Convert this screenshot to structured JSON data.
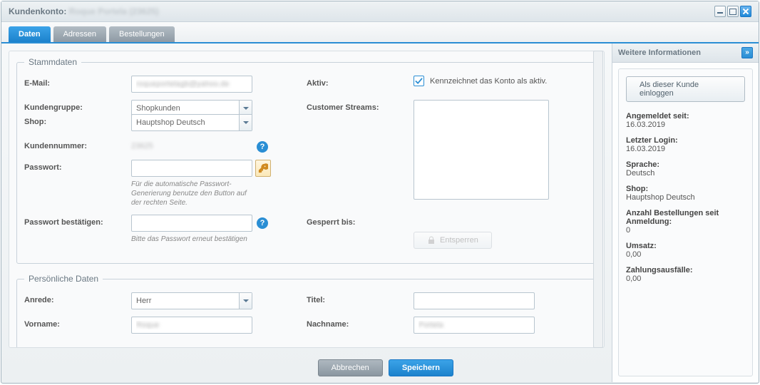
{
  "window": {
    "title_prefix": "Kundenkonto: ",
    "title_name": "Roque Portela (23625)"
  },
  "tabs": {
    "daten": "Daten",
    "adressen": "Adressen",
    "bestellungen": "Bestellungen"
  },
  "stammdaten": {
    "legend": "Stammdaten",
    "email_label": "E-Mail:",
    "email_value": "roqueportelagb@yahoo.de",
    "kundengruppe_label": "Kundengruppe:",
    "kundengruppe_value": "Shopkunden",
    "shop_label": "Shop:",
    "shop_value": "Hauptshop Deutsch",
    "kundennummer_label": "Kundennummer:",
    "kundennummer_value": "23625",
    "passwort_label": "Passwort:",
    "passwort_help": "Für die automatische Passwort-Generierung benutze den Button auf der rechten Seite.",
    "passwort_confirm_label": "Passwort bestätigen:",
    "passwort_confirm_help": "Bitte das Passwort erneut bestätigen",
    "aktiv_label": "Aktiv:",
    "aktiv_help": "Kennzeichnet das Konto als aktiv.",
    "streams_label": "Customer Streams:",
    "gesperrt_label": "Gesperrt bis:",
    "entsperren": "Entsperren"
  },
  "persoenlich": {
    "legend": "Persönliche Daten",
    "anrede_label": "Anrede:",
    "anrede_value": "Herr",
    "titel_label": "Titel:",
    "titel_value": "",
    "vorname_label": "Vorname:",
    "vorname_value": "Roque",
    "nachname_label": "Nachname:",
    "nachname_value": "Portela"
  },
  "footer": {
    "cancel": "Abbrechen",
    "save": "Speichern"
  },
  "side": {
    "header": "Weitere Informationen",
    "login_as": "Als dieser Kunde einloggen",
    "angemeldet_label": "Angemeldet seit:",
    "angemeldet_value": "16.03.2019",
    "letzter_login_label": "Letzter Login:",
    "letzter_login_value": "16.03.2019",
    "sprache_label": "Sprache:",
    "sprache_value": "Deutsch",
    "shop_label": "Shop:",
    "shop_value": "Hauptshop Deutsch",
    "bestellungen_label": "Anzahl Bestellungen seit Anmeldung:",
    "bestellungen_value": "0",
    "umsatz_label": "Umsatz:",
    "umsatz_value": "0,00",
    "ausfall_label": "Zahlungsausfälle:",
    "ausfall_value": "0,00"
  }
}
